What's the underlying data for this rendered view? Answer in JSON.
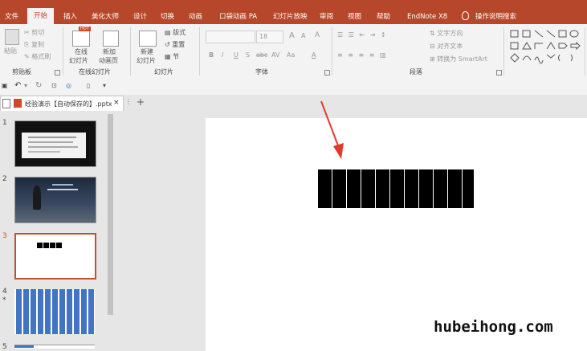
{
  "tabs": [
    "文件",
    "开始",
    "插入",
    "美化大师",
    "设计",
    "切换",
    "动画",
    "口袋动画 PA",
    "幻灯片放映",
    "审阅",
    "视图",
    "帮助",
    "EndNote X8",
    "操作说明搜索"
  ],
  "active_tab": "开始",
  "clipboard": {
    "paste": "粘贴",
    "cut": "剪切",
    "copy": "复制",
    "format_painter": "格式刷",
    "label": "剪贴板"
  },
  "online_slides": {
    "online": "在线",
    "online2": "幻灯片",
    "new": "新加",
    "new2": "动画页",
    "label": "在线幻灯片",
    "hot": "HOT"
  },
  "slides_group": {
    "new_slide": "新建",
    "new_slide2": "幻灯片",
    "layout": "版式",
    "reset": "重置",
    "section": "节",
    "label": "幻灯片"
  },
  "font": {
    "size": "18",
    "bold": "B",
    "italic": "I",
    "underline": "U",
    "strike": "S",
    "shadow": "abc",
    "spacing": "AV",
    "case": "Aa",
    "color": "A",
    "grow": "A",
    "shrink": "A",
    "clear": "A",
    "label": "字体"
  },
  "paragraph": {
    "direction": "文字方向",
    "align": "对齐文本",
    "smartart": "转换为 SmartArt",
    "label": "段落"
  },
  "document_tab": {
    "name": "经验演示【自动保存的】.pptx",
    "close": "×",
    "menu": "⋮",
    "add": "+"
  },
  "slide_numbers": [
    "1",
    "2",
    "3",
    "4",
    "5"
  ],
  "slide4_star": "*",
  "watermark": "hubeihong.com",
  "colors": {
    "accent": "#b7472a",
    "selection": "#c0532e",
    "slide4_blue": "#4472c4",
    "arrow": "#e03a2c"
  }
}
